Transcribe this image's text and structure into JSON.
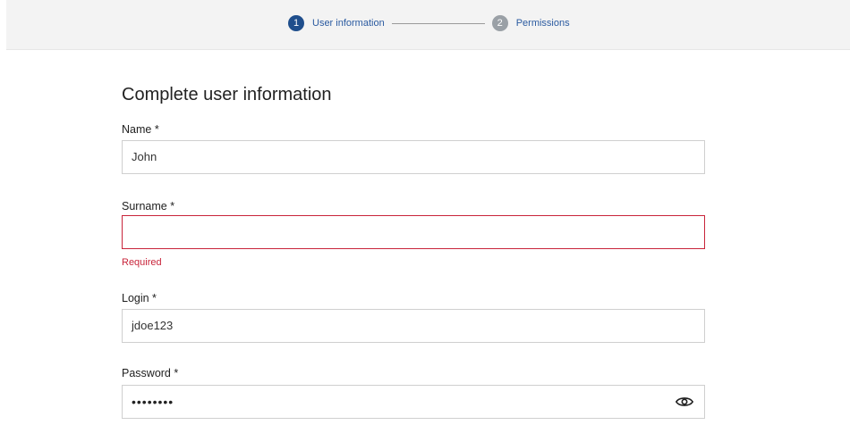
{
  "stepper": {
    "steps": [
      {
        "number": "1",
        "label": "User information",
        "state": "active"
      },
      {
        "number": "2",
        "label": "Permissions",
        "state": "inactive"
      }
    ]
  },
  "form": {
    "title": "Complete user information",
    "fields": {
      "name": {
        "label": "Name *",
        "value": "John"
      },
      "surname": {
        "label": "Surname *",
        "value": "",
        "error": "Required"
      },
      "login": {
        "label": "Login *",
        "value": "jdoe123"
      },
      "password": {
        "label": "Password *",
        "value": "••••••••",
        "toggle_icon": "eye-icon"
      }
    }
  },
  "colors": {
    "accent": "#1f4e8c",
    "link": "#2a5aa0",
    "error": "#c8243a",
    "step_inactive": "#9aa0a6"
  }
}
